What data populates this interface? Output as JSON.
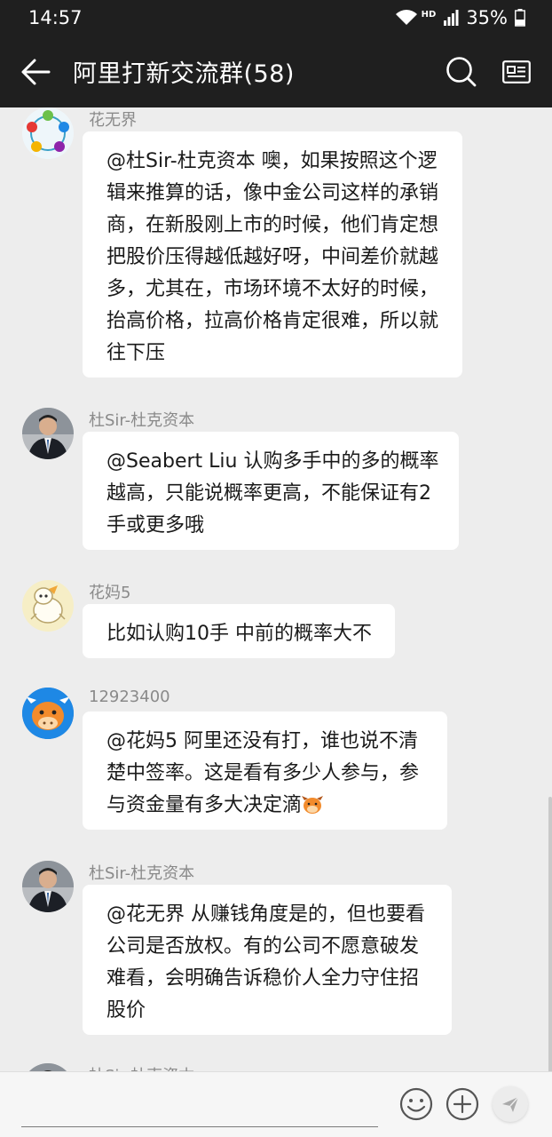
{
  "status": {
    "time": "14:57",
    "network": "HD",
    "battery": "35%"
  },
  "header": {
    "title": "阿里打新交流群(58)",
    "back_icon": "back-arrow-icon",
    "search_icon": "search-icon",
    "profile_icon": "group-card-icon"
  },
  "messages": [
    {
      "sender": "花无界",
      "text": "@杜Sir-杜克资本 噢，如果按照这个逻辑来推算的话，像中金公司这样的承销商，在新股刚上市的时候，他们肯定想把股价压得越低越好呀，中间差价就越多，尤其在，市场环境不太好的时候，抬高价格，拉高价格肯定很难，所以就往下压"
    },
    {
      "sender": "杜Sir-杜克资本",
      "text": "@Seabert Liu 认购多手中的多的概率越高，只能说概率更高，不能保证有2手或更多哦"
    },
    {
      "sender": "花妈5",
      "text": "比如认购10手 中前的概率大不"
    },
    {
      "sender": "12923400",
      "text": "@花妈5 阿里还没有打，谁也说不清楚中签率。这是看有多少人参与，参与资金量有多大决定滴"
    },
    {
      "sender": "杜Sir-杜克资本",
      "text": "@花无界 从赚钱角度是的，但也要看公司是否放权。有的公司不愿意破发难看，会明确告诉稳价人全力守住招股价"
    },
    {
      "sender": "杜Sir-杜克资本",
      "text": ""
    }
  ],
  "input": {
    "placeholder": "",
    "emoji_icon": "emoji-icon",
    "plus_icon": "plus-icon",
    "send_icon": "send-icon"
  }
}
